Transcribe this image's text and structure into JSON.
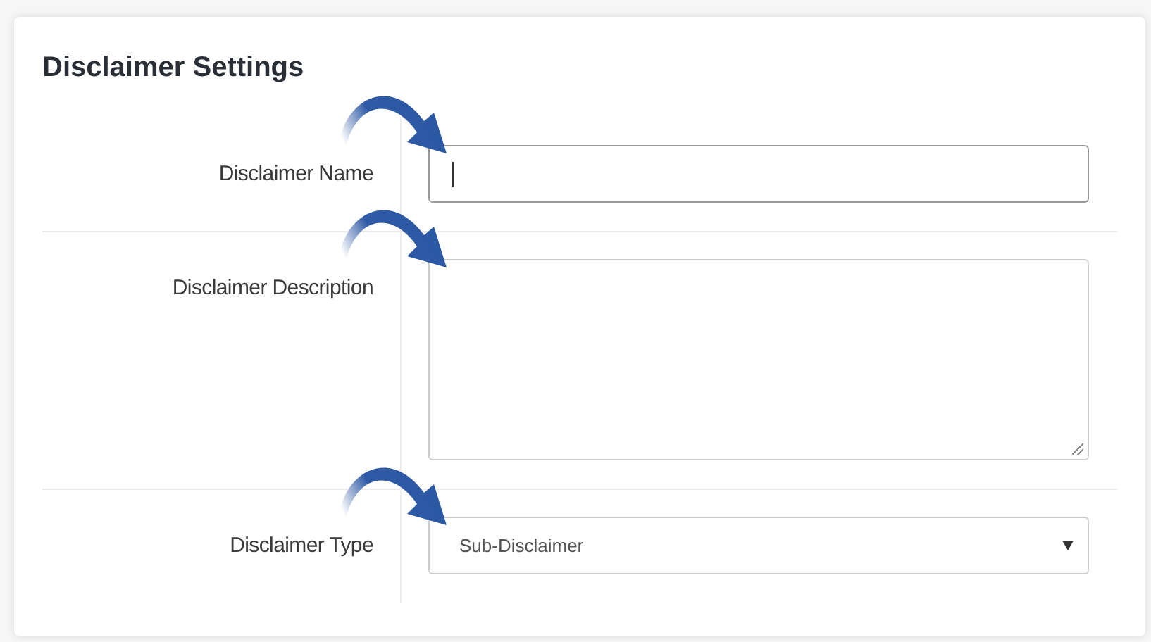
{
  "panel": {
    "title": "Disclaimer Settings"
  },
  "rows": [
    {
      "kind": "input",
      "label": "Disclaimer Name",
      "focused": true,
      "annotated": true
    },
    {
      "kind": "textarea",
      "label": "Disclaimer Description",
      "annotated": true
    },
    {
      "kind": "select",
      "label": "Disclaimer Type",
      "value": "Sub-Disclaimer",
      "annotated": true
    }
  ]
}
